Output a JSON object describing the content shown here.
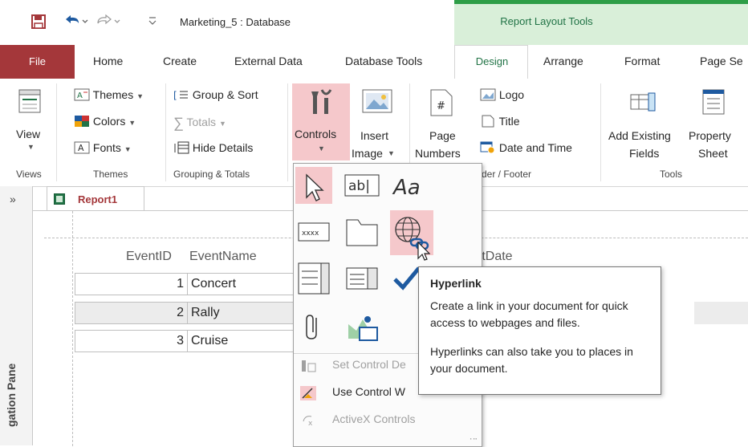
{
  "app": {
    "doc_title": "Marketing_5 : Database",
    "contextual_group": "Report Layout Tools"
  },
  "tabs": [
    {
      "label": "File"
    },
    {
      "label": "Home"
    },
    {
      "label": "Create"
    },
    {
      "label": "External Data"
    },
    {
      "label": "Database Tools"
    },
    {
      "label": "Design"
    },
    {
      "label": "Arrange"
    },
    {
      "label": "Format"
    },
    {
      "label": "Page Se"
    }
  ],
  "ribbon": {
    "views": {
      "view_label": "View",
      "group": "Views"
    },
    "themes": {
      "themes": "Themes",
      "colors": "Colors",
      "fonts": "Fonts",
      "group": "Themes"
    },
    "grouping": {
      "group_sort": "Group & Sort",
      "totals": "Totals",
      "hide_details": "Hide Details",
      "group": "Grouping & Totals"
    },
    "controls": {
      "controls": "Controls",
      "insert": "Insert",
      "image": "Image"
    },
    "header_footer": {
      "page": "Page",
      "numbers": "Numbers",
      "logo": "Logo",
      "title": "Title",
      "date_time": "Date and Time",
      "group": "der / Footer"
    },
    "tools": {
      "add_existing": "Add Existing",
      "fields": "Fields",
      "property": "Property",
      "sheet": "Sheet",
      "group": "Tools"
    }
  },
  "nav": {
    "collapse": "»",
    "pane_label": "gation Pane"
  },
  "document": {
    "tab_label": "Report1",
    "headers": {
      "event_id": "EventID",
      "event_name": "EventName",
      "start_date": "rtDate"
    },
    "rows": [
      {
        "id": "1",
        "name": "Concert"
      },
      {
        "id": "2",
        "name": "Rally"
      },
      {
        "id": "3",
        "name": "Cruise"
      }
    ]
  },
  "controls_menu": {
    "textbox_glyph": "ab|",
    "label_glyph": "Aa",
    "button_glyph": "xxxx",
    "set_control_defaults": "Set Control De",
    "use_control_wizards": "Use Control W",
    "activex_controls": "ActiveX Controls"
  },
  "tooltip": {
    "title": "Hyperlink",
    "body1": "Create a link in your document for quick access to webpages and files.",
    "body2": "Hyperlinks can also take you to places in your document."
  },
  "colors": {
    "file_tab": "#a4373a",
    "contextual_bg": "#d9efd9",
    "contextual_accent": "#217346",
    "selected_control": "#f5c8cb"
  }
}
